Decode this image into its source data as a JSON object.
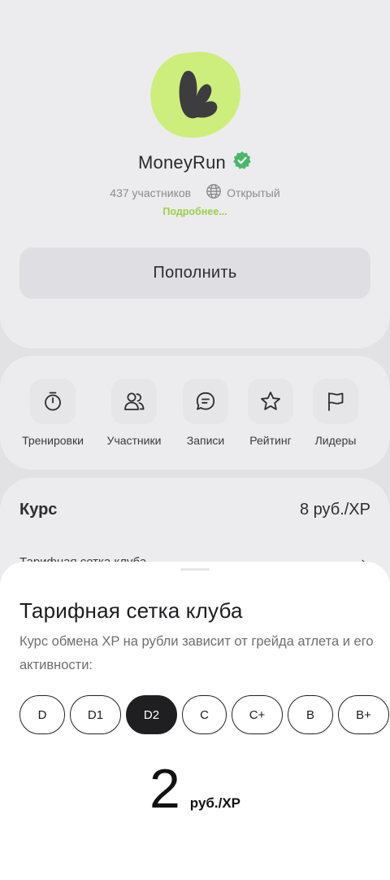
{
  "club": {
    "name": "MoneyRun",
    "members": "437 участников",
    "visibility": "Открытый",
    "more_link": "Подробнее...",
    "topup_label": "Пополнить"
  },
  "colors": {
    "logo_bg": "#cdee7c",
    "verified": "#4bb56c",
    "accent_link": "#9bcf4a"
  },
  "actions": [
    {
      "label": "Тренировки",
      "icon": "stopwatch-icon"
    },
    {
      "label": "Участники",
      "icon": "users-icon"
    },
    {
      "label": "Записи",
      "icon": "posts-icon"
    },
    {
      "label": "Рейтинг",
      "icon": "star-icon"
    },
    {
      "label": "Лидеры",
      "icon": "flag-icon"
    }
  ],
  "rate": {
    "label": "Курс",
    "value": "8 руб./XP",
    "grid_link": "Тарифная сетка клуба"
  },
  "sheet": {
    "title": "Тарифная сетка клуба",
    "description": "Курс обмена XP на рубли зависит от грейда атлета и его активности:",
    "grades": [
      "D",
      "D1",
      "D2",
      "C",
      "C+",
      "B",
      "B+"
    ],
    "selected_grade": "D2",
    "price_value": "2",
    "price_unit": "руб./XP"
  }
}
